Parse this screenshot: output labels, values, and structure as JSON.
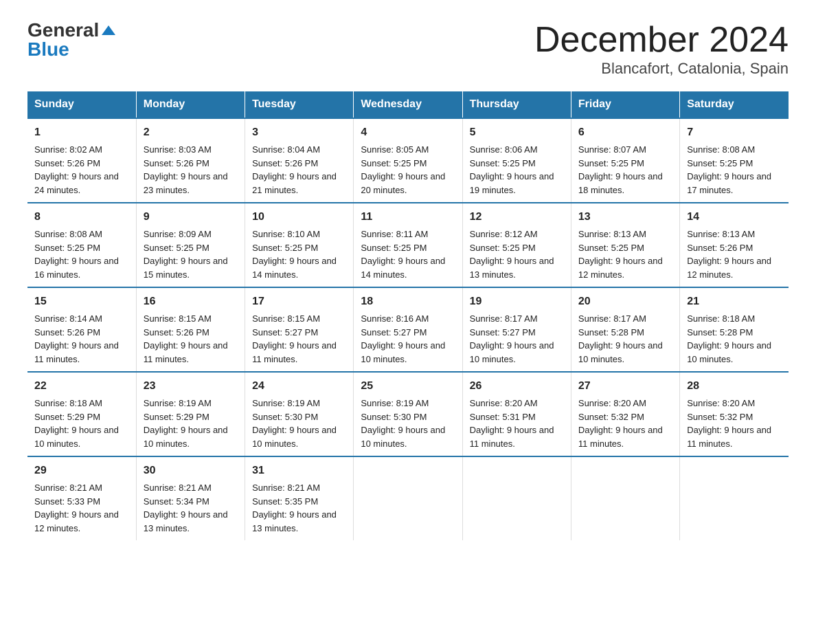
{
  "header": {
    "logo_general": "General",
    "logo_blue": "Blue",
    "month_title": "December 2024",
    "location": "Blancafort, Catalonia, Spain"
  },
  "days_of_week": [
    "Sunday",
    "Monday",
    "Tuesday",
    "Wednesday",
    "Thursday",
    "Friday",
    "Saturday"
  ],
  "weeks": [
    [
      {
        "day": "1",
        "sunrise": "Sunrise: 8:02 AM",
        "sunset": "Sunset: 5:26 PM",
        "daylight": "Daylight: 9 hours and 24 minutes."
      },
      {
        "day": "2",
        "sunrise": "Sunrise: 8:03 AM",
        "sunset": "Sunset: 5:26 PM",
        "daylight": "Daylight: 9 hours and 23 minutes."
      },
      {
        "day": "3",
        "sunrise": "Sunrise: 8:04 AM",
        "sunset": "Sunset: 5:26 PM",
        "daylight": "Daylight: 9 hours and 21 minutes."
      },
      {
        "day": "4",
        "sunrise": "Sunrise: 8:05 AM",
        "sunset": "Sunset: 5:25 PM",
        "daylight": "Daylight: 9 hours and 20 minutes."
      },
      {
        "day": "5",
        "sunrise": "Sunrise: 8:06 AM",
        "sunset": "Sunset: 5:25 PM",
        "daylight": "Daylight: 9 hours and 19 minutes."
      },
      {
        "day": "6",
        "sunrise": "Sunrise: 8:07 AM",
        "sunset": "Sunset: 5:25 PM",
        "daylight": "Daylight: 9 hours and 18 minutes."
      },
      {
        "day": "7",
        "sunrise": "Sunrise: 8:08 AM",
        "sunset": "Sunset: 5:25 PM",
        "daylight": "Daylight: 9 hours and 17 minutes."
      }
    ],
    [
      {
        "day": "8",
        "sunrise": "Sunrise: 8:08 AM",
        "sunset": "Sunset: 5:25 PM",
        "daylight": "Daylight: 9 hours and 16 minutes."
      },
      {
        "day": "9",
        "sunrise": "Sunrise: 8:09 AM",
        "sunset": "Sunset: 5:25 PM",
        "daylight": "Daylight: 9 hours and 15 minutes."
      },
      {
        "day": "10",
        "sunrise": "Sunrise: 8:10 AM",
        "sunset": "Sunset: 5:25 PM",
        "daylight": "Daylight: 9 hours and 14 minutes."
      },
      {
        "day": "11",
        "sunrise": "Sunrise: 8:11 AM",
        "sunset": "Sunset: 5:25 PM",
        "daylight": "Daylight: 9 hours and 14 minutes."
      },
      {
        "day": "12",
        "sunrise": "Sunrise: 8:12 AM",
        "sunset": "Sunset: 5:25 PM",
        "daylight": "Daylight: 9 hours and 13 minutes."
      },
      {
        "day": "13",
        "sunrise": "Sunrise: 8:13 AM",
        "sunset": "Sunset: 5:25 PM",
        "daylight": "Daylight: 9 hours and 12 minutes."
      },
      {
        "day": "14",
        "sunrise": "Sunrise: 8:13 AM",
        "sunset": "Sunset: 5:26 PM",
        "daylight": "Daylight: 9 hours and 12 minutes."
      }
    ],
    [
      {
        "day": "15",
        "sunrise": "Sunrise: 8:14 AM",
        "sunset": "Sunset: 5:26 PM",
        "daylight": "Daylight: 9 hours and 11 minutes."
      },
      {
        "day": "16",
        "sunrise": "Sunrise: 8:15 AM",
        "sunset": "Sunset: 5:26 PM",
        "daylight": "Daylight: 9 hours and 11 minutes."
      },
      {
        "day": "17",
        "sunrise": "Sunrise: 8:15 AM",
        "sunset": "Sunset: 5:27 PM",
        "daylight": "Daylight: 9 hours and 11 minutes."
      },
      {
        "day": "18",
        "sunrise": "Sunrise: 8:16 AM",
        "sunset": "Sunset: 5:27 PM",
        "daylight": "Daylight: 9 hours and 10 minutes."
      },
      {
        "day": "19",
        "sunrise": "Sunrise: 8:17 AM",
        "sunset": "Sunset: 5:27 PM",
        "daylight": "Daylight: 9 hours and 10 minutes."
      },
      {
        "day": "20",
        "sunrise": "Sunrise: 8:17 AM",
        "sunset": "Sunset: 5:28 PM",
        "daylight": "Daylight: 9 hours and 10 minutes."
      },
      {
        "day": "21",
        "sunrise": "Sunrise: 8:18 AM",
        "sunset": "Sunset: 5:28 PM",
        "daylight": "Daylight: 9 hours and 10 minutes."
      }
    ],
    [
      {
        "day": "22",
        "sunrise": "Sunrise: 8:18 AM",
        "sunset": "Sunset: 5:29 PM",
        "daylight": "Daylight: 9 hours and 10 minutes."
      },
      {
        "day": "23",
        "sunrise": "Sunrise: 8:19 AM",
        "sunset": "Sunset: 5:29 PM",
        "daylight": "Daylight: 9 hours and 10 minutes."
      },
      {
        "day": "24",
        "sunrise": "Sunrise: 8:19 AM",
        "sunset": "Sunset: 5:30 PM",
        "daylight": "Daylight: 9 hours and 10 minutes."
      },
      {
        "day": "25",
        "sunrise": "Sunrise: 8:19 AM",
        "sunset": "Sunset: 5:30 PM",
        "daylight": "Daylight: 9 hours and 10 minutes."
      },
      {
        "day": "26",
        "sunrise": "Sunrise: 8:20 AM",
        "sunset": "Sunset: 5:31 PM",
        "daylight": "Daylight: 9 hours and 11 minutes."
      },
      {
        "day": "27",
        "sunrise": "Sunrise: 8:20 AM",
        "sunset": "Sunset: 5:32 PM",
        "daylight": "Daylight: 9 hours and 11 minutes."
      },
      {
        "day": "28",
        "sunrise": "Sunrise: 8:20 AM",
        "sunset": "Sunset: 5:32 PM",
        "daylight": "Daylight: 9 hours and 11 minutes."
      }
    ],
    [
      {
        "day": "29",
        "sunrise": "Sunrise: 8:21 AM",
        "sunset": "Sunset: 5:33 PM",
        "daylight": "Daylight: 9 hours and 12 minutes."
      },
      {
        "day": "30",
        "sunrise": "Sunrise: 8:21 AM",
        "sunset": "Sunset: 5:34 PM",
        "daylight": "Daylight: 9 hours and 13 minutes."
      },
      {
        "day": "31",
        "sunrise": "Sunrise: 8:21 AM",
        "sunset": "Sunset: 5:35 PM",
        "daylight": "Daylight: 9 hours and 13 minutes."
      },
      null,
      null,
      null,
      null
    ]
  ]
}
